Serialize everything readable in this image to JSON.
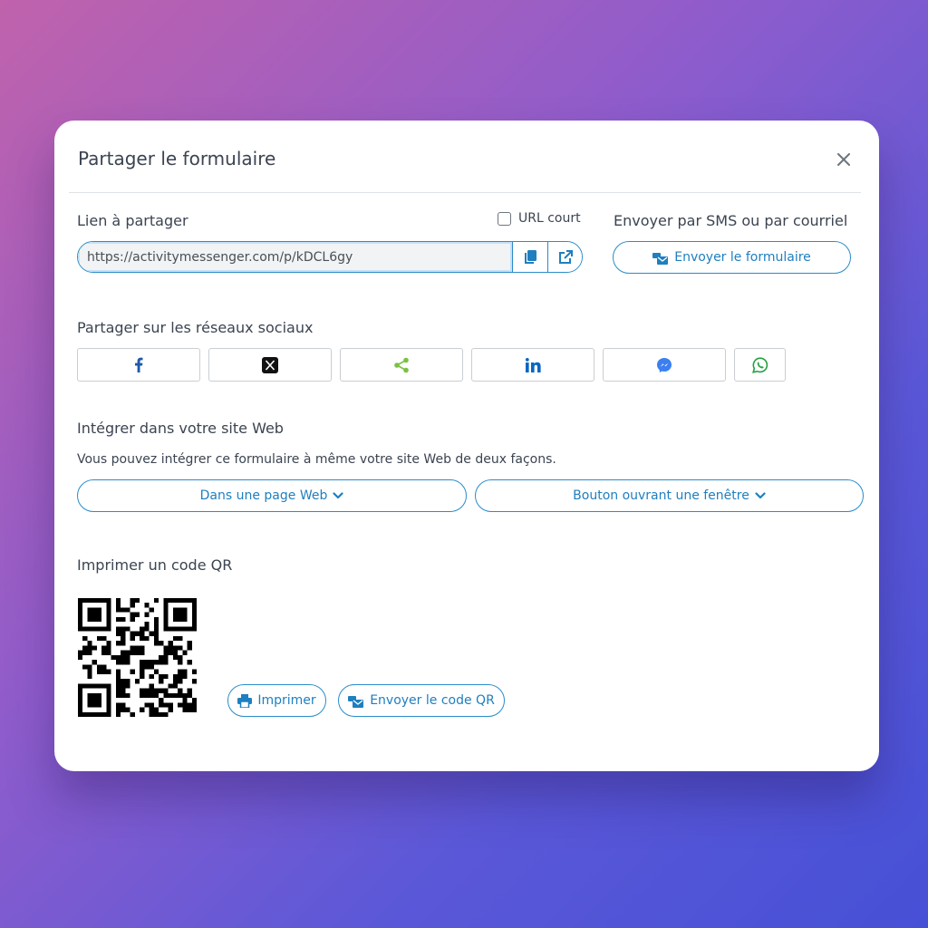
{
  "modal": {
    "title": "Partager le formulaire"
  },
  "share_link": {
    "label": "Lien à partager",
    "short_url_label": "URL court",
    "url_value": "https://activitymessenger.com/p/kDCL6gy"
  },
  "send": {
    "label": "Envoyer par SMS ou par courriel",
    "button_label": "Envoyer le formulaire"
  },
  "social": {
    "label": "Partager sur les réseaux sociaux",
    "networks": [
      "facebook",
      "x",
      "share",
      "linkedin",
      "messenger",
      "whatsapp"
    ],
    "colors": {
      "facebook": "#1f5aa8",
      "x": "#111111",
      "share": "#7ac142",
      "linkedin": "#0a66c2",
      "messenger": "#3b7ff0",
      "whatsapp": "#25a244"
    }
  },
  "embed": {
    "label": "Intégrer dans votre site Web",
    "description": "Vous pouvez intégrer ce formulaire à même votre site Web de deux façons.",
    "option_page": "Dans une page Web",
    "option_window": "Bouton ouvrant une fenêtre"
  },
  "qr": {
    "label": "Imprimer un code QR",
    "print_label": "Imprimer",
    "send_label": "Envoyer le code QR"
  },
  "colors": {
    "accent": "#2a8cc9",
    "accent_text": "#1f7fbf",
    "text": "#3b4451"
  }
}
